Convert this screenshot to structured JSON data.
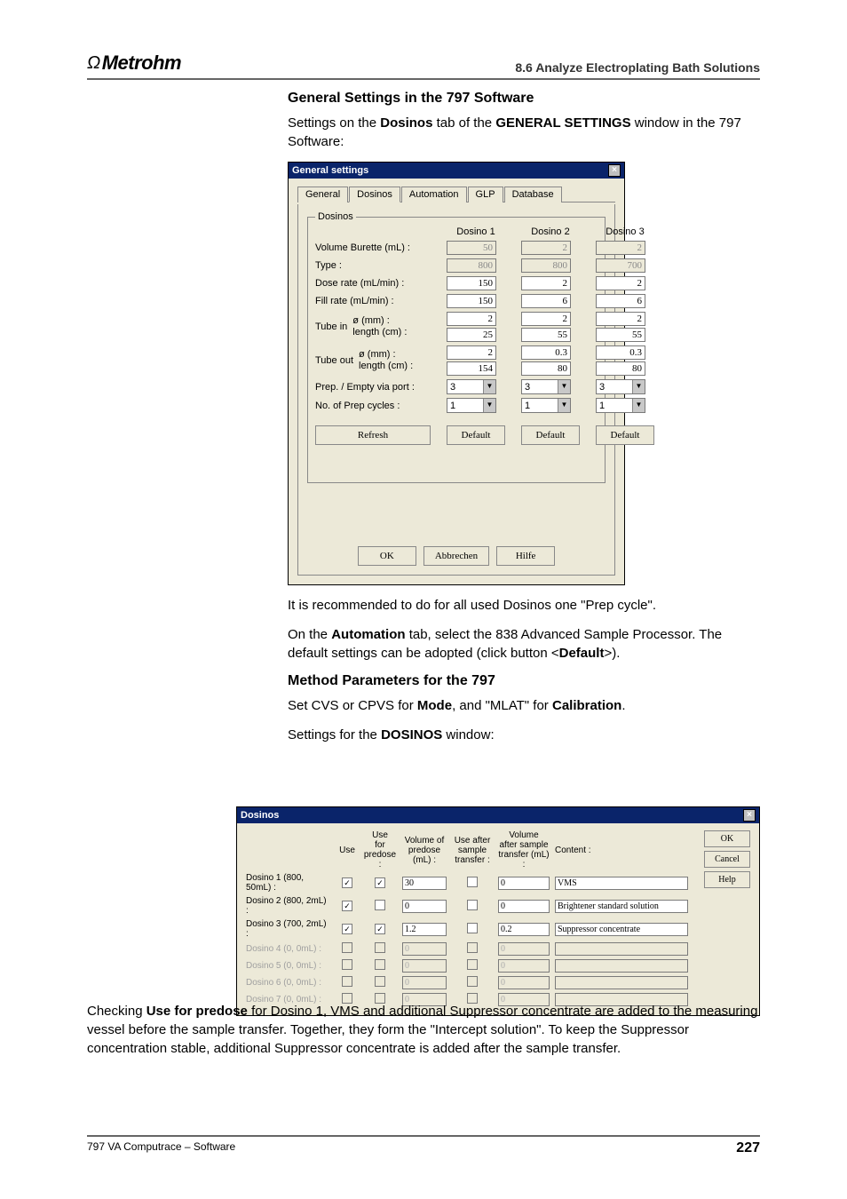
{
  "header": {
    "logo_text": "Metrohm",
    "right_text": "8.6  Analyze Electroplating Bath Solutions"
  },
  "text": {
    "sec1_title": "General Settings in the 797 Software",
    "sec1_para_a": "Settings on the ",
    "sec1_para_b": "Dosinos",
    "sec1_para_c": " tab of the ",
    "sec1_para_d": "GENERAL SETTINGS",
    "sec1_para_e": " window in the 797 Software:",
    "after_win1": "It is recommended to do for all used Dosinos one \"Prep cycle\".",
    "auto_a": "On the ",
    "auto_b": "Automation",
    "auto_c": " tab, select the 838 Advanced Sample Processor. The default settings can be adopted (click button <",
    "auto_d": "Default",
    "auto_e": ">).",
    "sec2_title": "Method Parameters for the 797",
    "mode_a": "Set CVS or CPVS for ",
    "mode_b": "Mode",
    "mode_c": ", and \"MLAT\" for ",
    "mode_d": "Calibration",
    "mode_e": ".",
    "dos_set_a": "Settings for the ",
    "dos_set_b": "DOSINOS",
    "dos_set_c": " window:",
    "final_a": "Checking ",
    "final_b": "Use for predose",
    "final_c": " for Dosino 1, VMS and additional Suppressor concentrate are added to the measuring vessel before the sample transfer. Together, they form the \"Intercept solution\". To keep the Suppressor concentration stable, additional Suppressor concentrate is added after the sample transfer."
  },
  "gs": {
    "title": "General settings",
    "tabs": [
      "General",
      "Dosinos",
      "Automation",
      "GLP",
      "Database"
    ],
    "group_label": "Dosinos",
    "cols": [
      "Dosino 1",
      "Dosino 2",
      "Dosino 3"
    ],
    "rows": {
      "vol_label": "Volume Burette (mL) :",
      "vol": [
        "50",
        "2",
        "2"
      ],
      "type_label": "Type :",
      "type": [
        "800",
        "800",
        "700"
      ],
      "dose_label": "Dose rate (mL/min) :",
      "dose": [
        "150",
        "2",
        "2"
      ],
      "fill_label": "Fill rate (mL/min) :",
      "fill": [
        "150",
        "6",
        "6"
      ],
      "tubein_label": "Tube in",
      "o_label": "ø (mm) :",
      "len_label": "length (cm) :",
      "tubein_o": [
        "2",
        "2",
        "2"
      ],
      "tubein_len": [
        "25",
        "55",
        "55"
      ],
      "tubeout_label": "Tube out",
      "tubeout_o": [
        "2",
        "0.3",
        "0.3"
      ],
      "tubeout_len": [
        "154",
        "80",
        "80"
      ],
      "prep_label": "Prep. / Empty via port :",
      "prep": [
        "3",
        "3",
        "3"
      ],
      "cycles_label": "No. of Prep cycles :",
      "cycles": [
        "1",
        "1",
        "1"
      ]
    },
    "refresh": "Refresh",
    "default_btn": "Default",
    "ok": "OK",
    "cancel": "Abbrechen",
    "help": "Hilfe"
  },
  "dw": {
    "title": "Dosinos",
    "headers": {
      "use": "Use",
      "predose": "Use\nfor\npredose :",
      "vol": "Volume of\npredose\n(mL) :",
      "after": "Use after\nsample\ntransfer :",
      "volafter": "Volume\nafter sample\ntransfer (mL) :",
      "content": "Content :"
    },
    "rows": [
      {
        "label": "Dosino 1 (800, 50mL) :",
        "use": true,
        "pre": true,
        "vol": "30",
        "after": false,
        "volafter": "0",
        "content": "VMS",
        "enabled": true
      },
      {
        "label": "Dosino 2 (800, 2mL) :",
        "use": true,
        "pre": false,
        "vol": "0",
        "after": false,
        "volafter": "0",
        "content": "Brightener standard solution",
        "enabled": true
      },
      {
        "label": "Dosino 3 (700, 2mL) :",
        "use": true,
        "pre": true,
        "vol": "1.2",
        "after": false,
        "volafter": "0.2",
        "content": "Suppressor concentrate",
        "enabled": true
      },
      {
        "label": "Dosino 4 (0, 0mL) :",
        "use": false,
        "pre": false,
        "vol": "0",
        "after": false,
        "volafter": "0",
        "content": "",
        "enabled": false
      },
      {
        "label": "Dosino 5 (0, 0mL) :",
        "use": false,
        "pre": false,
        "vol": "0",
        "after": false,
        "volafter": "0",
        "content": "",
        "enabled": false
      },
      {
        "label": "Dosino 6 (0, 0mL) :",
        "use": false,
        "pre": false,
        "vol": "0",
        "after": false,
        "volafter": "0",
        "content": "",
        "enabled": false
      },
      {
        "label": "Dosino 7 (0, 0mL) :",
        "use": false,
        "pre": false,
        "vol": "0",
        "after": false,
        "volafter": "0",
        "content": "",
        "enabled": false
      }
    ],
    "ok": "OK",
    "cancel": "Cancel",
    "help": "Help"
  },
  "footer": {
    "left": "797 VA Computrace – Software",
    "page": "227"
  }
}
